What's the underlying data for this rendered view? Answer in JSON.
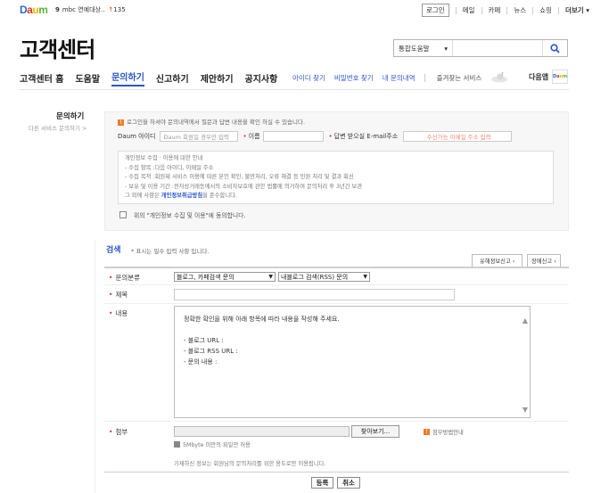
{
  "topbar": {
    "logo": {
      "d": "D",
      "a": "a",
      "u": "u",
      "m": "m"
    },
    "rank_num": "9",
    "rank_text": "mbc 연예대상..",
    "rank_change": "135",
    "login": "로그인",
    "menu": [
      "메일",
      "카페",
      "뉴스",
      "쇼핑"
    ],
    "more": "더보기"
  },
  "header": {
    "title": "고객센터",
    "search_scope": "통합도움말"
  },
  "nav": {
    "items": [
      "고객센터 홈",
      "도움말",
      "문의하기",
      "신고하기",
      "제안하기",
      "공지사항"
    ],
    "sub": [
      "아이디 찾기",
      "비밀번호 찾기",
      "내 문의내역"
    ],
    "fav": "즐겨찾는 서비스",
    "daum_app": "다음앱"
  },
  "sidebar": {
    "title": "문의하기",
    "sub": "다른 서비스 문의하기 >"
  },
  "notice": {
    "login_note": "로그인을 하셔야 문의내역에서 질문과 답변 내용을 확인 하실 수 있습니다.",
    "daum_id_label": "Daum 아이디",
    "daum_id_placeholder": "Daum 회원일 경우만 입력",
    "name_label": "이름",
    "email_label": "답변 받으실 E-mail주소",
    "email_placeholder": "수신가능 이메일 주소 입력",
    "privacy_lines": [
      "개인정보 수집 · 이용에 대한 안내",
      "- 수집 항목 :다음 아이디, 이메일 주소",
      "- 수집 목적 :회원제 서비스 이용에 따른 본인 확인, 불만처리, 오류 해결 등 민원 처리 및 결과 회신",
      "- 보유 및 이용 기간 :전자상거래등에서의 소비자보호에 관한 법률에 의거하여 문의처리 후 3년간 보관"
    ],
    "privacy_last_pre": "그 외에 사항은",
    "privacy_link": "개인정보취급방침",
    "privacy_last_post": "을 준수합니다.",
    "agree_text": "위의 \"개인정보 수집 및 이용\"에 동의합니다."
  },
  "form": {
    "title": "검색",
    "required_note": "* 표시는 필수 입력 사항 입니다.",
    "btn_harmful": "유해정보신고",
    "btn_error": "장애신고",
    "category_label": "문의분류",
    "category1": "블로그, 카페검색 문의",
    "category2": "내블로그 검색(RSS) 문의",
    "subject_label": "제목",
    "content_label": "내용",
    "content_lines": [
      "정확한 확인을 위해 아래 항목에 따라 내용을 작성해 주세요.",
      "",
      " - 블로그 URL :",
      " - 블로그 RSS URL :",
      " - 문의 내용 :"
    ],
    "attach_label": "첨부",
    "browse": "찾아보기...",
    "attach_guide": "첨부방법안내",
    "file_size": "5Mbyte 미만의 파일만 허용",
    "purpose": "기재하신 정보는 회원님의 문의처리를 위한 용도로만 이용됩니다.",
    "submit": "등록",
    "cancel": "취소"
  }
}
